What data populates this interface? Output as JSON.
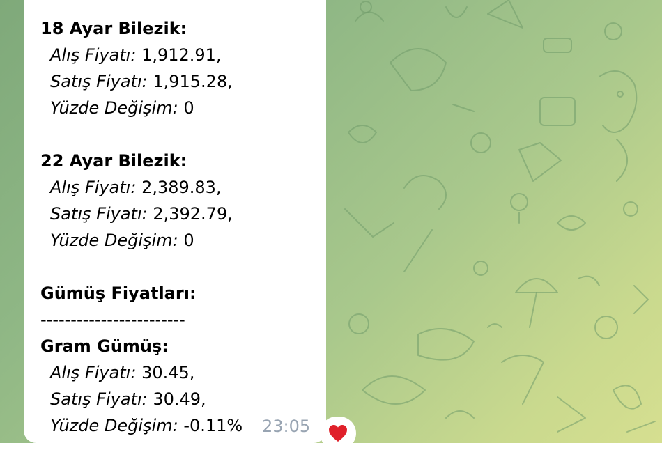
{
  "message": {
    "blocks": [
      {
        "heading": "18 Ayar Bilezik:",
        "rows": [
          {
            "key": "Alış Fiyatı:",
            "value": " 1,912.91,"
          },
          {
            "key": "Satış Fiyatı:",
            "value": " 1,915.28,"
          },
          {
            "key": "Yüzde Değişim:",
            "value": " 0"
          }
        ]
      },
      {
        "heading": "22 Ayar Bilezik:",
        "rows": [
          {
            "key": "Alış Fiyatı:",
            "value": " 2,389.83,"
          },
          {
            "key": "Satış Fiyatı:",
            "value": " 2,392.79,"
          },
          {
            "key": "Yüzde Değişim:",
            "value": " 0"
          }
        ]
      },
      {
        "heading": "Gümüş Fiyatları:",
        "divider": "------------------------",
        "subheading": "Gram Gümüş:",
        "rows": [
          {
            "key": "Alış Fiyatı:",
            "value": " 30.45,"
          },
          {
            "key": "Satış Fiyatı:",
            "value": " 30.49,"
          },
          {
            "key": "Yüzde Değişim:",
            "value": " -0.11%"
          }
        ]
      }
    ],
    "time": "23:05",
    "reaction": {
      "icon": "heart-icon",
      "color": "#e0202a"
    }
  },
  "colors": {
    "bubble": "#ffffff",
    "time_text": "#98a4b2",
    "background_start": "#7fa97a",
    "background_end": "#d6df90"
  }
}
